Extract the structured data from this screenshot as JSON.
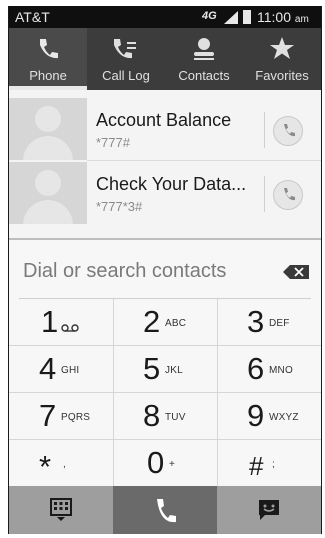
{
  "status_bar": {
    "carrier": "AT&T",
    "network": "4G",
    "time": "11:00",
    "ampm": "am"
  },
  "tabs": [
    {
      "label": "Phone",
      "icon": "phone-icon",
      "active": true
    },
    {
      "label": "Call Log",
      "icon": "call-log-icon",
      "active": false
    },
    {
      "label": "Contacts",
      "icon": "contacts-icon",
      "active": false
    },
    {
      "label": "Favorites",
      "icon": "star-icon",
      "active": false
    }
  ],
  "contacts": [
    {
      "name": "Account Balance",
      "number": "*777#"
    },
    {
      "name": "Check Your Data...",
      "number": "*777*3#"
    }
  ],
  "search": {
    "placeholder": "Dial or search contacts"
  },
  "keypad": [
    {
      "digit": "1",
      "letters": "voicemail-icon"
    },
    {
      "digit": "2",
      "letters": "ABC"
    },
    {
      "digit": "3",
      "letters": "DEF"
    },
    {
      "digit": "4",
      "letters": "GHI"
    },
    {
      "digit": "5",
      "letters": "JKL"
    },
    {
      "digit": "6",
      "letters": "MNO"
    },
    {
      "digit": "7",
      "letters": "PQRS"
    },
    {
      "digit": "8",
      "letters": "TUV"
    },
    {
      "digit": "9",
      "letters": "WXYZ"
    },
    {
      "digit": "*",
      "letters": ","
    },
    {
      "digit": "0",
      "letters": "+"
    },
    {
      "digit": "#",
      "letters": ";"
    }
  ],
  "actions": [
    {
      "name": "dialpad-toggle-icon"
    },
    {
      "name": "call-icon"
    },
    {
      "name": "message-icon"
    }
  ],
  "colors": {
    "status_bar": "#0f0f0f",
    "tab_bar": "#3c3c3c",
    "call_button": "#6a6a6a",
    "side_buttons": "#9e9e9e",
    "background": "#f4f4f4"
  }
}
